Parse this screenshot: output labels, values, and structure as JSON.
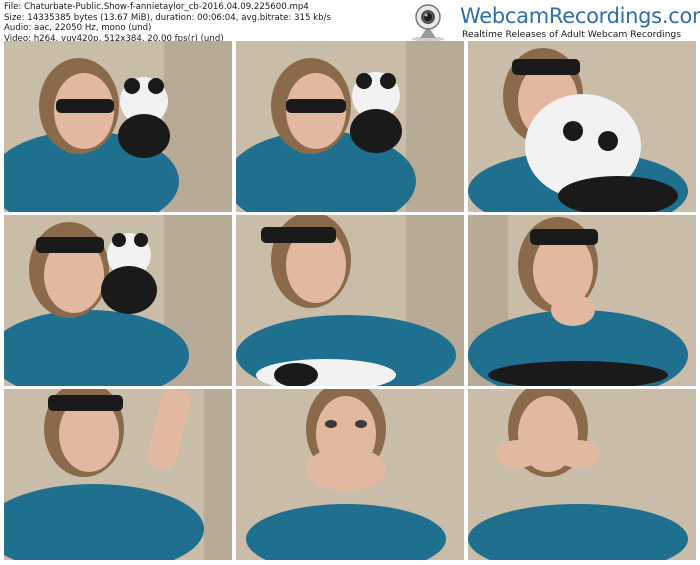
{
  "info": {
    "file_line": "File: Chaturbate-Public.Show-f-annietaylor_cb-2016.04.09.225600.mp4",
    "size_line": "Size: 14335385 bytes (13.67 MiB), duration: 00:06:04, avg.bitrate: 315 kb/s",
    "audio_line": "Audio: aac, 22050 Hz, mono (und)",
    "video_line": "Video: h264, yuv420p, 512x384, 20.00 fps(r) (und)"
  },
  "logo": {
    "brand": "WebcamRecordings.com",
    "tagline": "Realtime Releases of Adult Webcam Recordings"
  },
  "thumbnails": [
    {
      "label": "thumb-1",
      "description": "woman in sunglasses lying on couch with panda plush beside face"
    },
    {
      "label": "thumb-2",
      "description": "woman in sunglasses lying on couch with panda plush beside face"
    },
    {
      "label": "thumb-3",
      "description": "woman in sunglasses holding panda plush close to face"
    },
    {
      "label": "thumb-4",
      "description": "woman in sunglasses with panda plush against cheek"
    },
    {
      "label": "thumb-5",
      "description": "woman in sunglasses, panda plush on chest"
    },
    {
      "label": "thumb-6",
      "description": "woman in sunglasses, hand on chin"
    },
    {
      "label": "thumb-7",
      "description": "woman in sunglasses with arm raised"
    },
    {
      "label": "thumb-8",
      "description": "woman without sunglasses, hands over mouth"
    },
    {
      "label": "thumb-9",
      "description": "woman resting chin on hands"
    }
  ],
  "colors": {
    "brand_blue": "#2f6ea8",
    "dress_blue": "#1f6f8f",
    "pillow": "#cbbfae"
  }
}
